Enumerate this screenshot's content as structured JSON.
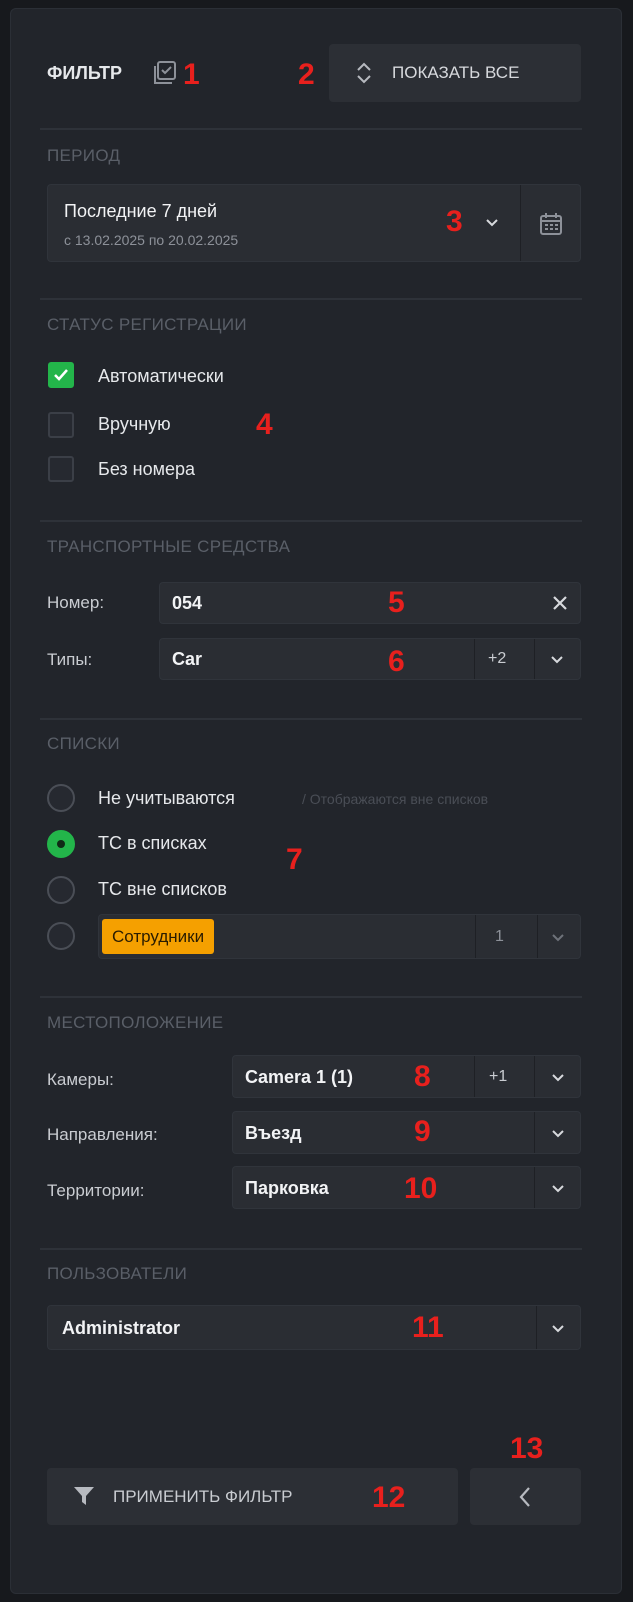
{
  "header": {
    "title": "ФИЛЬТР",
    "show_all_label": "ПОКАЗАТЬ ВСЕ"
  },
  "period": {
    "section": "ПЕРИОД",
    "value": "Последние 7 дней",
    "range": "с 13.02.2025 по 20.02.2025"
  },
  "registration": {
    "section": "СТАТУС РЕГИСТРАЦИИ",
    "options": [
      {
        "label": "Автоматически",
        "checked": true
      },
      {
        "label": "Вручную",
        "checked": false
      },
      {
        "label": "Без номера",
        "checked": false
      }
    ]
  },
  "vehicles": {
    "section": "ТРАНСПОРТНЫЕ СРЕДСТВА",
    "number_label": "Номер:",
    "number_value": "054",
    "types_label": "Типы:",
    "types_value": "Car",
    "types_extra": "+2"
  },
  "lists": {
    "section": "СПИСКИ",
    "options": [
      {
        "label": "Не учитываются",
        "selected": false
      },
      {
        "label": "ТС в списках",
        "selected": true
      },
      {
        "label": "ТС вне списков",
        "selected": false
      }
    ],
    "hint": "/ Отображаются вне списков",
    "tag": "Сотрудники",
    "tag_count": "1"
  },
  "location": {
    "section": "МЕСТОПОЛОЖЕНИЕ",
    "cameras_label": "Камеры:",
    "cameras_value": "Camera 1 (1)",
    "cameras_extra": "+1",
    "directions_label": "Направления:",
    "directions_value": "Въезд",
    "territories_label": "Территории:",
    "territories_value": "Парковка"
  },
  "users": {
    "section": "ПОЛЬЗОВАТЕЛИ",
    "value": "Administrator"
  },
  "footer": {
    "apply_label": "ПРИМЕНИТЬ ФИЛЬТР"
  },
  "annotations": [
    "1",
    "2",
    "3",
    "4",
    "5",
    "6",
    "7",
    "8",
    "9",
    "10",
    "11",
    "12",
    "13"
  ],
  "colors": {
    "background": "#22252b",
    "accent_green": "#23b54a",
    "tag_orange": "#f5a000",
    "annotation_red": "#e8201d"
  }
}
